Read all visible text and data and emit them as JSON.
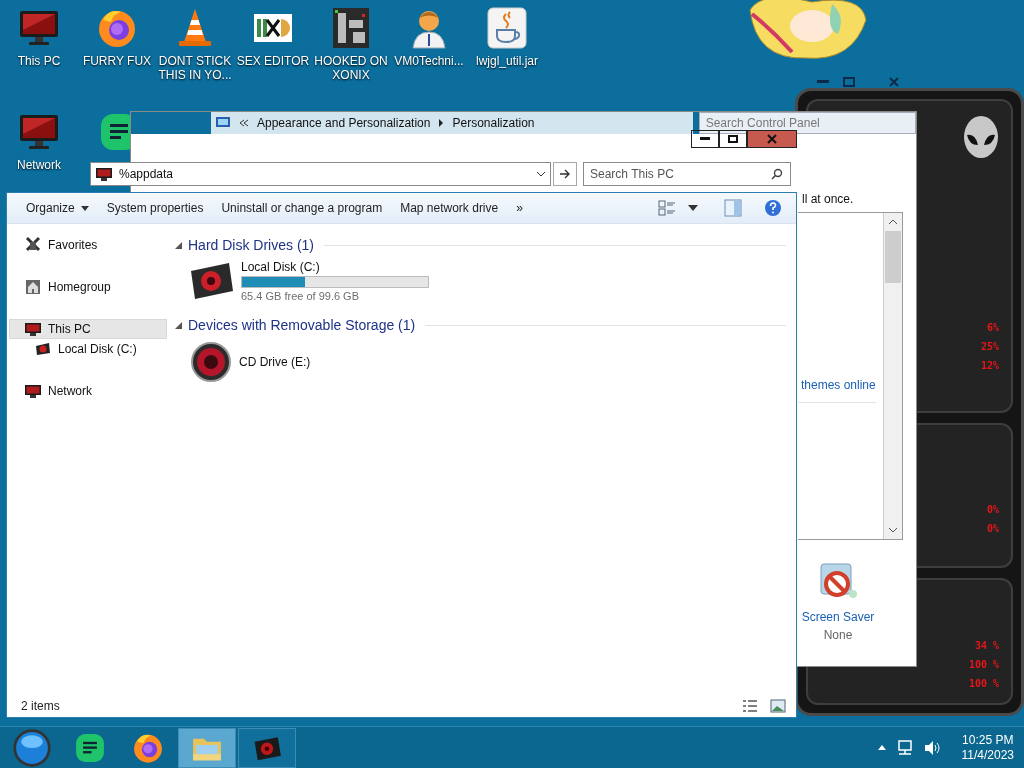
{
  "desktop_icons": [
    {
      "label": "This PC",
      "kind": "monitor"
    },
    {
      "label": "FURRY FUX",
      "kind": "browser"
    },
    {
      "label": "DONT STICK THIS IN YO...",
      "kind": "cone"
    },
    {
      "label": "SEX EDITOR",
      "kind": "hexeditor"
    },
    {
      "label": "HOOKED ON XONIX",
      "kind": "maze"
    },
    {
      "label": "VM0Techni...",
      "kind": "person"
    },
    {
      "label": "lwjgl_util.jar",
      "kind": "java"
    }
  ],
  "desktop_icons_row2": [
    {
      "label": "Network",
      "kind": "monitor"
    },
    {
      "kind": "notes"
    }
  ],
  "control_panel": {
    "breadcrumb": [
      "Appearance and Personalization",
      "Personalization"
    ],
    "search": {
      "placeholder": "Search Control Panel"
    },
    "text_fragment": "ll at once.",
    "link": "themes online",
    "screen_saver": {
      "label": "Screen Saver",
      "value": "None"
    }
  },
  "explorer": {
    "address": "%appdata",
    "search": {
      "placeholder": "Search This PC"
    },
    "toolbar": [
      {
        "label": "Organize",
        "dropdown": true
      },
      {
        "label": "System properties",
        "dropdown": false
      },
      {
        "label": "Uninstall or change a program",
        "dropdown": false
      },
      {
        "label": "Map network drive",
        "dropdown": false
      },
      {
        "label": "»",
        "dropdown": false
      }
    ],
    "nav": [
      {
        "label": "Favorites",
        "kind": "favorites",
        "selected": false
      },
      {
        "label": "Homegroup",
        "kind": "homegroup",
        "selected": false
      },
      {
        "label": "This PC",
        "kind": "pc",
        "selected": true,
        "children": [
          {
            "label": "Local Disk (C:)",
            "kind": "disk",
            "selected": false
          }
        ]
      },
      {
        "label": "Network",
        "kind": "network",
        "selected": false
      }
    ],
    "groups": [
      {
        "title": "Hard Disk Drives (1)",
        "items": [
          {
            "name": "Local Disk (C:)",
            "kind": "hdd",
            "level": 0.34,
            "free": "65.4 GB free of 99.6 GB"
          }
        ]
      },
      {
        "title": "Devices with Removable Storage (1)",
        "items": [
          {
            "name": "CD Drive (E:)",
            "kind": "cd"
          }
        ]
      }
    ],
    "status": "2 items"
  },
  "gadget": {
    "sections": [
      {
        "readings": [
          "6%",
          "25%",
          "12%"
        ]
      },
      {
        "readings": [
          "0%",
          "0%"
        ]
      },
      {
        "readings": [
          "34 %",
          "100 %",
          "100 %"
        ]
      }
    ]
  },
  "taskbar": {
    "apps": [
      {
        "kind": "orb",
        "running": false,
        "selected": false
      },
      {
        "kind": "notes",
        "running": false,
        "selected": false
      },
      {
        "kind": "browser",
        "running": false,
        "selected": false
      },
      {
        "kind": "folder",
        "running": true,
        "selected": true
      },
      {
        "kind": "app",
        "running": true,
        "selected": false
      }
    ],
    "time": "10:25 PM",
    "date": "11/4/2023"
  }
}
